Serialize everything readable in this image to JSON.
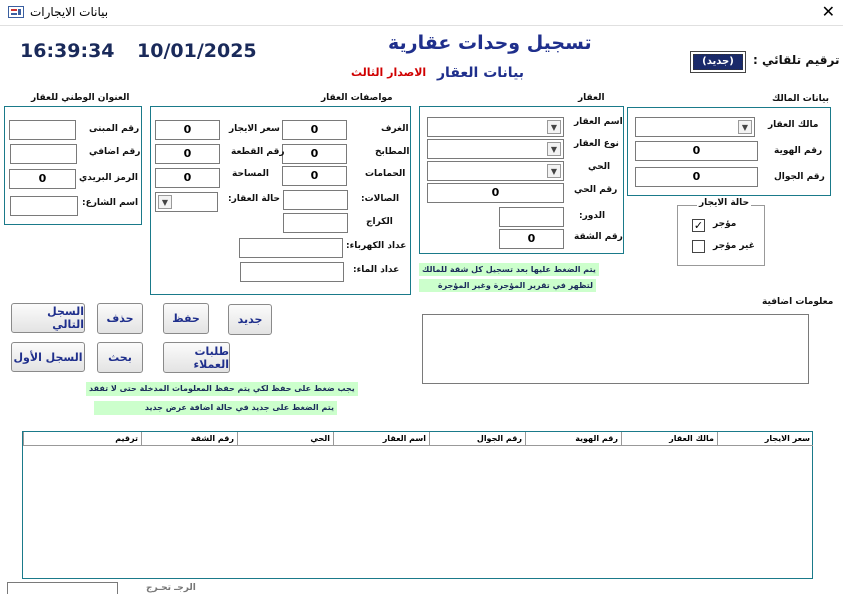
{
  "window": {
    "title": "بيانات الايجارات",
    "close_label": "✕"
  },
  "header": {
    "time": "16:39:34",
    "date": "10/01/2025",
    "title": "تسجيل وحدات عقارية",
    "subtitle": "بيانات العقار",
    "version": "الاصدار الثالث",
    "serial_label": "ترقيم تلقائي :",
    "serial_value": "(جديد)"
  },
  "owner_group": {
    "title": "بيانات المالك",
    "owner_label": "مالك العقار",
    "owner_value": "",
    "id_label": "رقم الهوية",
    "id_value": "0",
    "mobile_label": "رقم الجوال",
    "mobile_value": "0"
  },
  "rent_status": {
    "title": "حالة الايجار",
    "rented_label": "مؤجر",
    "rented_checked": true,
    "not_rented_label": "غير مؤجر",
    "not_rented_checked": false
  },
  "property_group": {
    "title": "العقار",
    "name_label": "اسم العقار",
    "type_label": "نوع العقار",
    "district_label": "الحي",
    "district_no_label": "رقم الحي",
    "district_no_value": "0",
    "floor_label": "الدور:",
    "floor_value": "",
    "apartment_label": "رقم الشقة",
    "apartment_value": "0"
  },
  "specs_group": {
    "title": "مواصفات العقار",
    "rooms_label": "الغرف",
    "rooms_value": "0",
    "kitchens_label": "المطابخ",
    "kitchens_value": "0",
    "baths_label": "الحمامات",
    "baths_value": "0",
    "halls_label": "الصالات:",
    "halls_value": "",
    "garage_label": "الكراج",
    "garage_value": "",
    "rent_price_label": "سعر الايجار",
    "rent_price_value": "0",
    "plot_label": "رقم القطعة",
    "plot_value": "0",
    "area_label": "المساحة",
    "area_value": "0",
    "condition_label": "حالة العقار:",
    "electric_label": "عداد الكهرباء:",
    "electric_value": "",
    "water_label": "عداد الماء:",
    "water_value": ""
  },
  "address_group": {
    "title": "العنوان الوطني للعقار",
    "building_label": "رقم المبنى",
    "building_value": "",
    "extra_label": "رقم اضافي",
    "extra_value": "",
    "postal_label": "الرمز البريدي",
    "postal_value": "0",
    "street_label": "اسم الشارع:",
    "street_value": ""
  },
  "notes": {
    "owner_note_line1": "يتم الضغط عليها بعد تسجيل كل شقة للمالك",
    "owner_note_line2": "لتظهر في تقرير المؤجرة وغير المؤجرة",
    "save_note": "يجب ضغط على حفظ لكي يتم حفظ المعلومات المدخلة حتى لا تفقد",
    "new_note": "يتم الضغط على جديد في حالة اضافة عرض جديد",
    "extra_info_label": "معلومات اضافية",
    "extra_info_value": ""
  },
  "buttons": {
    "new": "جديد",
    "save": "حفظ",
    "delete": "حذف",
    "next": "السجل التالي",
    "first": "السجل الأول",
    "search": "بحث",
    "client_requests": "طلبات العملاء"
  },
  "list": {
    "columns": [
      "سعر الايجار",
      "مالك العقار",
      "رقم الهوية",
      "رقم الجوال",
      "اسم العقار",
      "الحي",
      "رقم الشقة",
      "ترقيم"
    ]
  },
  "footer": {
    "record_label": "الرجـ تحـرج"
  }
}
